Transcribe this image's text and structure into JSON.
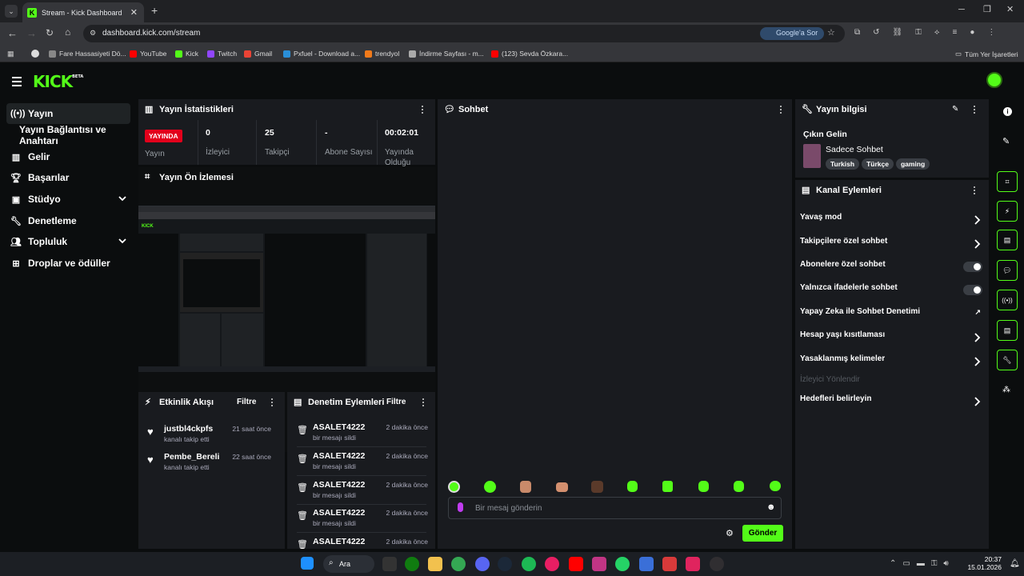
{
  "browser": {
    "tab_title": "Stream - Kick Dashboard",
    "url": "dashboard.kick.com/stream",
    "google_btn": "Google'a Sor",
    "bookmarks": [
      {
        "label": "Fare Hassasiyeti Dö...",
        "color": "#888"
      },
      {
        "label": "YouTube",
        "color": "#ff0000"
      },
      {
        "label": "Kick",
        "color": "#53fc18"
      },
      {
        "label": "Twitch",
        "color": "#9146ff"
      },
      {
        "label": "Gmail",
        "color": "#ea4335"
      },
      {
        "label": "Pxfuel - Download a...",
        "color": "#2a8fd8"
      },
      {
        "label": "trendyol",
        "color": "#f27a1a"
      },
      {
        "label": "İndirme Sayfası - m...",
        "color": "#aaa"
      },
      {
        "label": "(123) Sevda Özkara...",
        "color": "#ff0000"
      }
    ],
    "all_bookmarks": "Tüm Yer İşaretleri"
  },
  "app": {
    "logo": "KICK",
    "logo_badge": "BETA",
    "accent": "#53fc18"
  },
  "sidebar": {
    "items": [
      {
        "label": "Yayın",
        "icon": "broadcast-icon"
      },
      {
        "label": "Yayın Bağlantısı ve Anahtarı",
        "icon": ""
      },
      {
        "label": "Gelir",
        "icon": "revenue-icon"
      },
      {
        "label": "Başarılar",
        "icon": "trophy-icon"
      },
      {
        "label": "Stüdyo",
        "icon": "studio-icon"
      },
      {
        "label": "Denetleme",
        "icon": "wrench-icon"
      },
      {
        "label": "Topluluk",
        "icon": "community-icon"
      },
      {
        "label": "Droplar ve ödüller",
        "icon": "drops-icon"
      }
    ]
  },
  "stats": {
    "title": "Yayın İstatistikleri",
    "live_badge": "YAYINDA",
    "live_label": "Yayın",
    "viewers_value": "0",
    "viewers_label": "İzleyici",
    "followers_value": "25",
    "followers_label": "Takipçi",
    "subs_value": "-",
    "subs_label": "Abone Sayısı",
    "uptime_value": "00:02:01",
    "uptime_label": "Yayında Olduğu"
  },
  "preview": {
    "title": "Yayın Ön İzlemesi"
  },
  "activity": {
    "title": "Etkinlik Akışı",
    "filter": "Filtre",
    "items": [
      {
        "name": "justbl4ckpfs",
        "sub": "kanalı takip etti",
        "time": "21 saat önce"
      },
      {
        "name": "Pembe_Bereli",
        "sub": "kanalı takip etti",
        "time": "22 saat önce"
      }
    ]
  },
  "moderation": {
    "title": "Denetim Eylemleri",
    "filter": "Filtre",
    "items": [
      {
        "name": "ASALET4222",
        "sub": "bir mesajı sildi",
        "time": "2 dakika önce"
      },
      {
        "name": "ASALET4222",
        "sub": "bir mesajı sildi",
        "time": "2 dakika önce"
      },
      {
        "name": "ASALET4222",
        "sub": "bir mesajı sildi",
        "time": "2 dakika önce"
      },
      {
        "name": "ASALET4222",
        "sub": "bir mesajı sildi",
        "time": "2 dakika önce"
      },
      {
        "name": "ASALET4222",
        "sub": "",
        "time": "2 dakika önce"
      }
    ]
  },
  "chat": {
    "title": "Sohbet",
    "placeholder": "Bir mesaj gönderin",
    "send": "Gönder"
  },
  "stream_info": {
    "title": "Yayın bilgisi",
    "stream_title": "Çıkın Gelin",
    "category": "Sadece Sohbet",
    "tags": [
      "Turkish",
      "Türkçe",
      "gaming"
    ]
  },
  "channel_actions": {
    "title": "Kanal Eylemleri",
    "items": [
      {
        "label": "Yavaş mod",
        "type": "chevron"
      },
      {
        "label": "Takipçilere özel sohbet",
        "type": "chevron"
      },
      {
        "label": "Abonelere özel sohbet",
        "type": "toggle"
      },
      {
        "label": "Yalnızca ifadelerle sohbet",
        "type": "toggle"
      },
      {
        "label": "Yapay Zeka ile Sohbet Denetimi",
        "type": "external"
      },
      {
        "label": "Hesap yaşı kısıtlaması",
        "type": "chevron"
      },
      {
        "label": "Yasaklanmış kelimeler",
        "type": "chevron"
      },
      {
        "label": "İzleyici Yönlendir",
        "type": "disabled"
      },
      {
        "label": "Hedefleri belirleyin",
        "type": "chevron"
      }
    ]
  },
  "taskbar": {
    "search": "Ara",
    "time": "20:37",
    "date": "15.01.2026"
  }
}
